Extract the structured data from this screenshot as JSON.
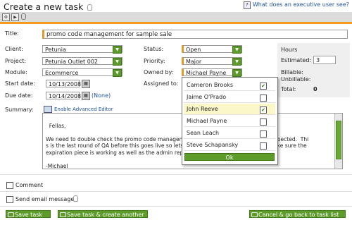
{
  "page_title": "Create a new task",
  "help_link": "What does an executive user see?",
  "form": {
    "title_label": "Title:",
    "title_value": "promo code management for sample sale",
    "client_label": "Client:",
    "client_value": "Petunia",
    "project_label": "Project:",
    "project_value": "Petunia Outlet 002",
    "module_label": "Module:",
    "module_value": "Ecommerce",
    "start_label": "Start date:",
    "start_value": "10/13/2008",
    "due_label": "Due date:",
    "due_value": "10/14/2008",
    "due_none": "(None)",
    "status_label": "Status:",
    "status_value": "Open",
    "priority_label": "Priority:",
    "priority_value": "Major",
    "owned_label": "Owned by:",
    "owned_value": "Michael Payne",
    "assigned_label": "Assigned to:",
    "summary_label": "Summary:",
    "advanced_editor": "Enable Advanced Editor",
    "summary_text": "Fellas,\n\nWe need to double check the promo code managem                                            g as expected.  Thi\ns is the last round of QA before this goes live so lets                                            and make sure the\nexpiration piece is working as well as the admin repo\n\n-Michael"
  },
  "hours": {
    "title": "Hours",
    "estimated_label": "Estimated:",
    "estimated_value": "3",
    "billable_label": "Billable:",
    "unbillable_label": "Unbillable:",
    "total_label": "Total:",
    "total_value": "0"
  },
  "assignees": [
    {
      "name": "Cameron Brooks",
      "checked": "✔"
    },
    {
      "name": "Jaime O'Prado",
      "checked": ""
    },
    {
      "name": "John Reeve",
      "checked": "✔"
    },
    {
      "name": "Michael Payne",
      "checked": ""
    },
    {
      "name": "Sean Leach",
      "checked": ""
    },
    {
      "name": "Steve Schapansky",
      "checked": ""
    }
  ],
  "popup_ok": "Ok",
  "comment_label": "Comment",
  "email_label": "Send email message",
  "buttons": {
    "save": "Save task",
    "save_another": "Save task & create another",
    "cancel": "Cancel & go back to task list"
  },
  "colors": {
    "accent": "#f29a1d",
    "button_green": "#5d9c2b",
    "link": "#1a4f9c"
  }
}
